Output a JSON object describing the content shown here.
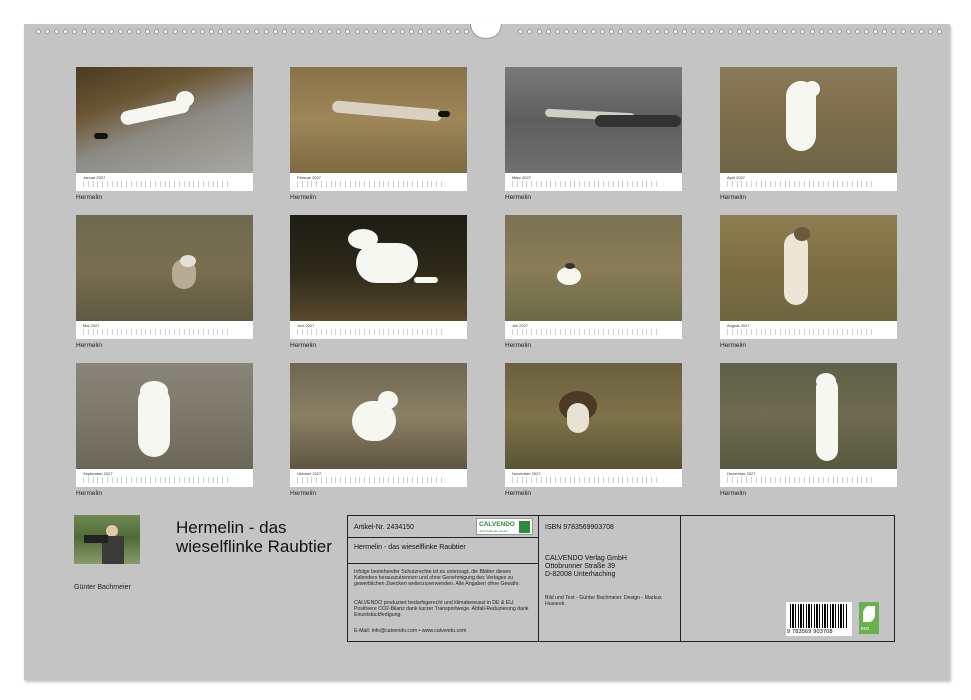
{
  "months": [
    {
      "name": "Januar 2027",
      "caption": "Hermelin"
    },
    {
      "name": "Februar 2027",
      "caption": "Hermelin"
    },
    {
      "name": "März 2027",
      "caption": "Hermelin"
    },
    {
      "name": "April 2027",
      "caption": "Hermelin"
    },
    {
      "name": "Mai 2027",
      "caption": "Hermelin"
    },
    {
      "name": "Juni 2027",
      "caption": "Hermelin"
    },
    {
      "name": "Juli 2027",
      "caption": "Hermelin"
    },
    {
      "name": "August 2027",
      "caption": "Hermelin"
    },
    {
      "name": "September 2027",
      "caption": "Hermelin"
    },
    {
      "name": "Oktober 2027",
      "caption": "Hermelin"
    },
    {
      "name": "November 2027",
      "caption": "Hermelin"
    },
    {
      "name": "Dezember 2027",
      "caption": "Hermelin"
    }
  ],
  "author": {
    "name": "Günter Bachmeier"
  },
  "title": "Hermelin - das wieselflinke Raubtier",
  "info": {
    "article": "Artikel-Nr. 2434150",
    "logo": "CALVENDO",
    "logo_sub": "Jetzt Kalender kaufen",
    "calendar_title": "Hermelin - das wieselflinke Raubtier",
    "legal1": "Infolge bestehender Schutzrechte ist es untersagt, die Blätter dieses Kalenders herauszutrennen und ohne Genehmigung des Verlages zu gewerblichen Zwecken weiterzuverwenden. Alle Angaben ohne Gewähr.",
    "legal2": "CALVENDO produziert bedarfsgerecht und klimabewusst in DE & EU. Positivere CO2-Bilanz dank kurzer Transportwege. Abfall-Reduzierung dank Einzelstückfertigung.",
    "contact": "E-Mail: info@calvendo.com • www.calvendo.com",
    "isbn": "ISBN 9783569903708",
    "publisher_name": "CALVENDO Verlag GmbH",
    "publisher_street": "Ottobrunner Straße 39",
    "publisher_city": "D-82008 Unterhaching",
    "credits": "Bild und Text - Günter Bachmeier. Design - Markus Husarek.",
    "barcode_number": "9 783569 903708",
    "eco_label": "eco"
  },
  "colors": {
    "background": "#c4c4c4",
    "brand_green": "#2d8c3c"
  }
}
